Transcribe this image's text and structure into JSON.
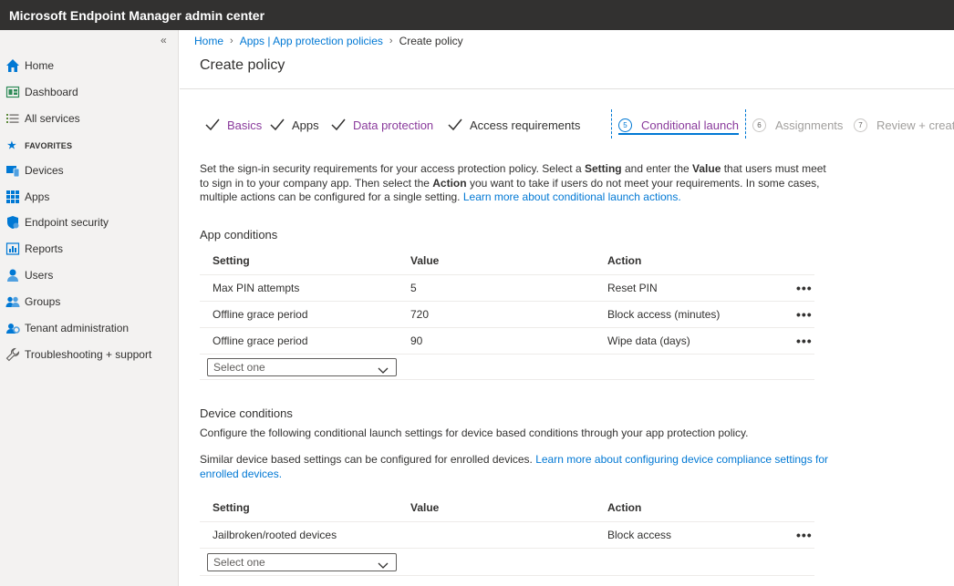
{
  "app": {
    "title": "Microsoft Endpoint Manager admin center"
  },
  "sidebar": {
    "collapse_icon": "double-chevron-left-icon",
    "items": [
      {
        "label": "Home",
        "icon": "home-icon"
      },
      {
        "label": "Dashboard",
        "icon": "dashboard-icon"
      },
      {
        "label": "All services",
        "icon": "list-icon"
      }
    ],
    "favorites_label": "FAVORITES",
    "favorites": [
      {
        "label": "Devices",
        "icon": "devices-icon"
      },
      {
        "label": "Apps",
        "icon": "apps-grid-icon"
      },
      {
        "label": "Endpoint security",
        "icon": "shield-icon"
      },
      {
        "label": "Reports",
        "icon": "reports-icon"
      },
      {
        "label": "Users",
        "icon": "user-icon"
      },
      {
        "label": "Groups",
        "icon": "groups-icon"
      },
      {
        "label": "Tenant administration",
        "icon": "tenant-admin-icon"
      },
      {
        "label": "Troubleshooting + support",
        "icon": "wrench-icon"
      }
    ]
  },
  "breadcrumb": {
    "home": "Home",
    "apps": "Apps | App protection policies",
    "current": "Create policy"
  },
  "page": {
    "title": "Create policy"
  },
  "wizard": {
    "steps": [
      {
        "label": "Basics",
        "state": "done"
      },
      {
        "label": "Apps",
        "state": "done"
      },
      {
        "label": "Data protection",
        "state": "done"
      },
      {
        "label": "Access requirements",
        "state": "done"
      },
      {
        "number": "5",
        "label": "Conditional launch",
        "state": "active"
      },
      {
        "number": "6",
        "label": "Assignments",
        "state": "future"
      },
      {
        "number": "7",
        "label": "Review + create",
        "state": "future"
      }
    ]
  },
  "description": {
    "part1": "Set the sign-in security requirements for your access protection policy. Select a ",
    "bold1": "Setting",
    "part2": " and enter the ",
    "bold2": "Value",
    "part3": " that users must meet to sign in to your company app. Then select the ",
    "bold3": "Action",
    "part4": " you want to take if users do not meet your requirements. In some cases, multiple actions can be configured for a single setting. ",
    "link": "Learn more about conditional launch actions."
  },
  "app_conditions": {
    "title": "App conditions",
    "columns": {
      "setting": "Setting",
      "value": "Value",
      "action": "Action"
    },
    "rows": [
      {
        "setting": "Max PIN attempts",
        "value": "5",
        "action": "Reset PIN"
      },
      {
        "setting": "Offline grace period",
        "value": "720",
        "action": "Block access (minutes)"
      },
      {
        "setting": "Offline grace period",
        "value": "90",
        "action": "Wipe data (days)"
      }
    ],
    "more_label": "•••",
    "select_placeholder": "Select one"
  },
  "device_conditions": {
    "title": "Device conditions",
    "intro": "Configure the following conditional launch settings for device based conditions through your app protection policy.",
    "note": "Similar device based settings can be configured for enrolled devices. ",
    "note_link": "Learn more about configuring device compliance settings for enrolled devices.",
    "columns": {
      "setting": "Setting",
      "value": "Value",
      "action": "Action"
    },
    "rows": [
      {
        "setting": "Jailbroken/rooted devices",
        "value": "",
        "action": "Block access"
      }
    ],
    "more_label": "•••",
    "select_placeholder": "Select one"
  },
  "colors": {
    "topbar": "#323130",
    "sidebar_bg": "#f3f2f1",
    "accent_blue": "#0078d4",
    "step_purple": "#8a3b9c"
  }
}
